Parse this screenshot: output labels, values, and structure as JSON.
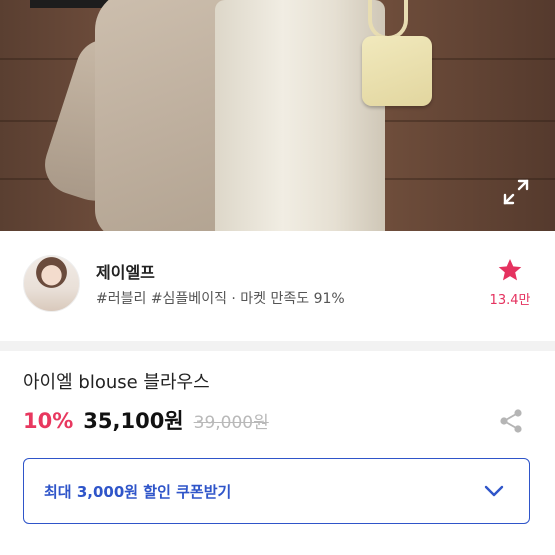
{
  "seller": {
    "name": "제이엘프",
    "tags": "#러블리 #심플베이직 · 마켓 만족도 91%",
    "favorite_count": "13.4만"
  },
  "product": {
    "title": "아이엘 blouse 블라우스",
    "discount": "10%",
    "price": "35,100원",
    "original_price": "39,000원"
  },
  "coupon": {
    "label": "최대 3,000원 할인 쿠폰받기"
  },
  "icons": {
    "expand": "expand-icon",
    "favorite": "star-icon",
    "share": "share-icon",
    "chevron": "chevron-down-icon"
  },
  "colors": {
    "accent_pink": "#e8385f",
    "coupon_blue": "#2f55c9",
    "text_primary": "#222222",
    "strikethrough_gray": "#b9b9b9"
  }
}
